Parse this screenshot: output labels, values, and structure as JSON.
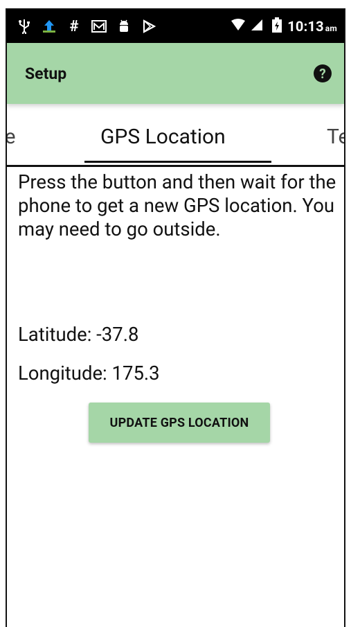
{
  "status_bar": {
    "icons": [
      "usb-icon",
      "upload-icon",
      "hashtag-icon",
      "gmail-icon",
      "android-icon",
      "play-store-icon",
      "wifi-icon",
      "signal-icon",
      "battery-icon"
    ],
    "time": "10:13",
    "ampm": "am"
  },
  "app_bar": {
    "title": "Setup",
    "help_icon": "?"
  },
  "tabs": {
    "items": [
      "ne",
      "GPS Location",
      "Te"
    ],
    "selected_index": 1
  },
  "content": {
    "description": "Press the button and then wait for the phone to get a new GPS location. You may need to go outside.",
    "latitude_label": "Latitude: -37.8",
    "longitude_label": "Longitude: 175.3",
    "update_button_label": "UPDATE GPS LOCATION"
  },
  "colors": {
    "primary": "#a5d6a7",
    "status_bar": "#000000",
    "text": "#111111"
  }
}
